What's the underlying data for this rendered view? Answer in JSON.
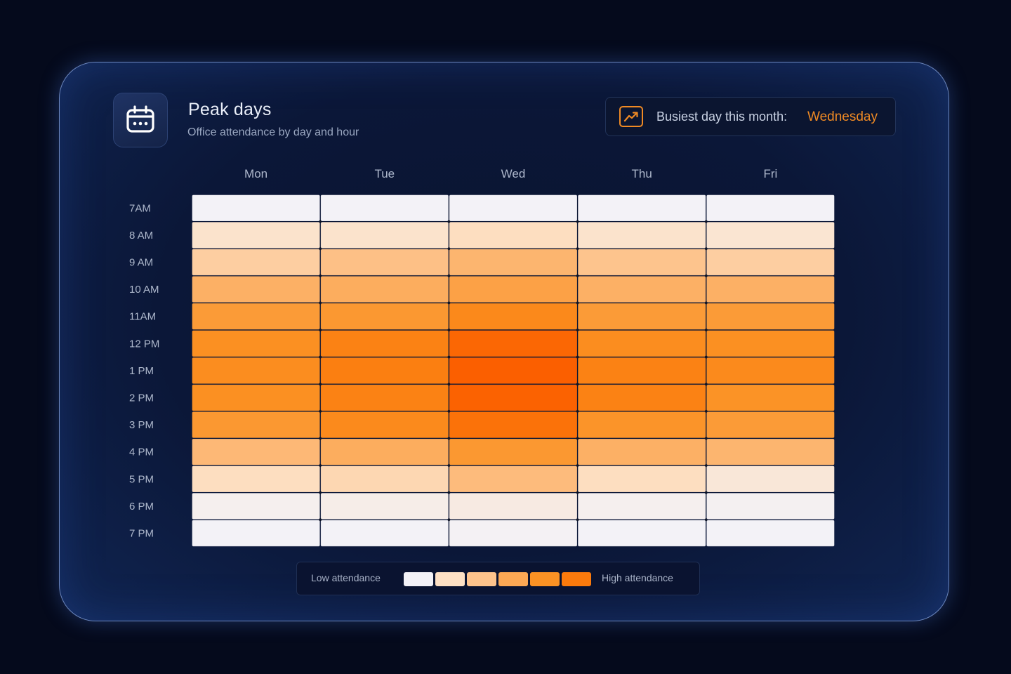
{
  "header": {
    "title": "Peak days",
    "subtitle": "Office attendance by day and hour",
    "icon": "calendar-icon"
  },
  "badge": {
    "label": "Busiest day this month:",
    "value": "Wednesday",
    "icon": "trending-up-icon",
    "value_color": "#f08a24"
  },
  "legend": {
    "low_label": "Low attendance",
    "high_label": "High attendance",
    "swatch_colors": [
      "#f3f2f7",
      "#fde0c4",
      "#fdc38c",
      "#fca854",
      "#fb9224",
      "#fb7a0c"
    ]
  },
  "chart_data": {
    "type": "heatmap",
    "title": "Peak days",
    "subtitle": "Office attendance by day and hour",
    "x_labels": [
      "Mon",
      "Tue",
      "Wed",
      "Thu",
      "Fri"
    ],
    "y_labels": [
      "7AM",
      "8 AM",
      "9 AM",
      "10 AM",
      "11AM",
      "12 PM",
      "1 PM",
      "2 PM",
      "3 PM",
      "4 PM",
      "5 PM",
      "6 PM",
      "7 PM"
    ],
    "value_range": [
      0,
      1
    ],
    "values": [
      [
        0.0,
        0.0,
        0.0,
        0.0,
        0.0
      ],
      [
        0.14,
        0.14,
        0.18,
        0.14,
        0.12
      ],
      [
        0.27,
        0.35,
        0.42,
        0.33,
        0.27
      ],
      [
        0.45,
        0.47,
        0.55,
        0.45,
        0.45
      ],
      [
        0.6,
        0.62,
        0.73,
        0.6,
        0.6
      ],
      [
        0.68,
        0.78,
        0.95,
        0.7,
        0.68
      ],
      [
        0.7,
        0.8,
        1.0,
        0.78,
        0.72
      ],
      [
        0.68,
        0.78,
        0.98,
        0.78,
        0.66
      ],
      [
        0.62,
        0.72,
        0.88,
        0.65,
        0.6
      ],
      [
        0.4,
        0.47,
        0.62,
        0.45,
        0.42
      ],
      [
        0.18,
        0.22,
        0.38,
        0.18,
        0.1
      ],
      [
        0.03,
        0.05,
        0.07,
        0.03,
        0.02
      ],
      [
        0.0,
        0.0,
        0.01,
        0.0,
        0.0
      ]
    ],
    "color_scale": [
      "#f3f2f7",
      "#fde0c4",
      "#fdc38c",
      "#fca854",
      "#fb9224",
      "#fb7a0c",
      "#fb5f00"
    ],
    "legend": {
      "position": "bottom",
      "low_label": "Low attendance",
      "high_label": "High attendance"
    },
    "grid": true
  }
}
